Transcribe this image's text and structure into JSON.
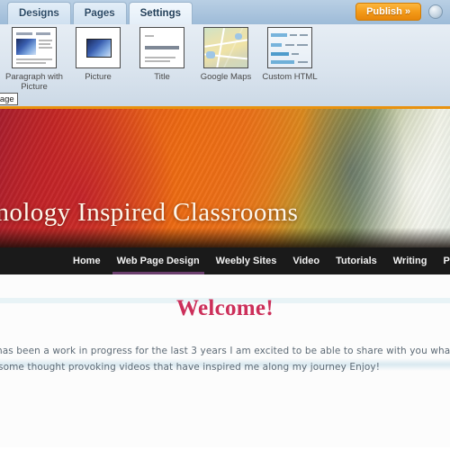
{
  "editor": {
    "tabs": [
      {
        "label": "Designs",
        "active": false
      },
      {
        "label": "Pages",
        "active": false
      },
      {
        "label": "Settings",
        "active": true
      }
    ],
    "publish_label": "Publish »",
    "help_icon": "help-circle-icon",
    "drag_tooltip": "to page",
    "palette_items": [
      {
        "label": "Paragraph with Picture",
        "icon": "paragraph-with-picture-thumbnail"
      },
      {
        "label": "Picture",
        "icon": "picture-thumbnail"
      },
      {
        "label": "Title",
        "icon": "title-thumbnail"
      },
      {
        "label": "Google Maps",
        "icon": "google-maps-thumbnail"
      },
      {
        "label": "Custom HTML",
        "icon": "custom-html-thumbnail"
      }
    ]
  },
  "site": {
    "banner_title": "Technology Inspired Classrooms",
    "nav": [
      {
        "label": "Home",
        "active": false
      },
      {
        "label": "Web Page Design",
        "active": true
      },
      {
        "label": "Weebly Sites",
        "active": false
      },
      {
        "label": "Video",
        "active": false
      },
      {
        "label": "Tutorials",
        "active": false
      },
      {
        "label": "Writing",
        "active": false
      },
      {
        "label": "Potp",
        "active": false
      }
    ],
    "heading": "Welcome!",
    "paragraph_line1": "e has been a work in progress for the last 3 years   I am excited to be able to share with you what I have learne",
    "paragraph_line2": "some thought provoking videos that have inspired me along my journey   Enjoy!"
  },
  "colors": {
    "publish_orange": "#f39a18",
    "nav_black": "#1a1a1a",
    "welcome_pink": "#cc2f5a",
    "nav_active_underline": "#6b3f6e",
    "banner_top_rule": "#e8920f",
    "chrome_blue": "#9dbbd8"
  }
}
